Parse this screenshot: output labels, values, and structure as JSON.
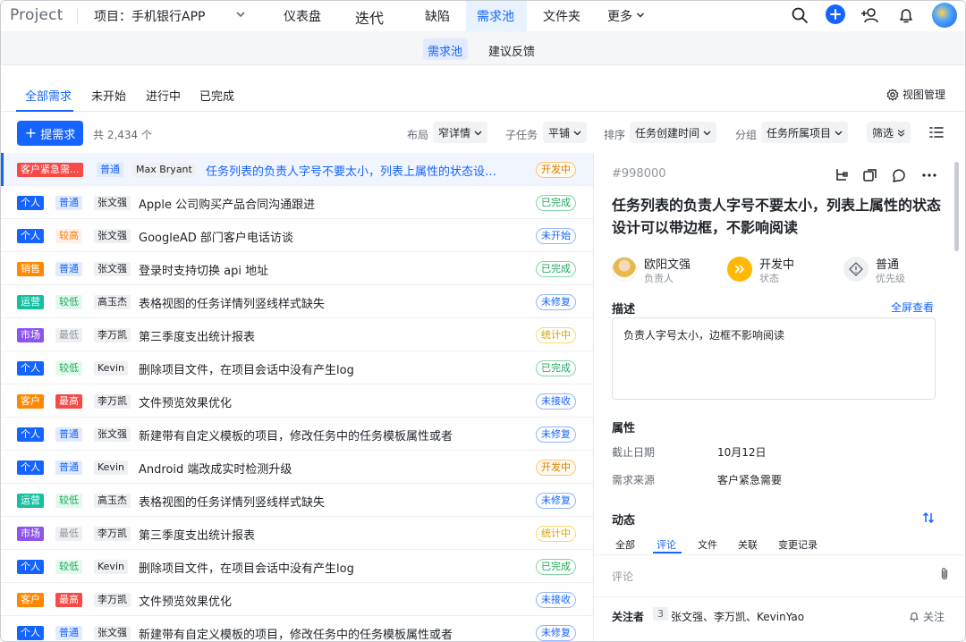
{
  "app": {
    "logo": "Project",
    "project": "项目：手机银行APP"
  },
  "nav": {
    "items": [
      "仪表盘",
      "迭代",
      "缺陷",
      "需求池",
      "文件夹",
      "更多"
    ],
    "active": "需求池"
  },
  "subnav": {
    "items": [
      "需求池",
      "建议反馈"
    ],
    "active": "需求池"
  },
  "tabs": {
    "items": [
      "全部需求",
      "未开始",
      "进行中",
      "已完成"
    ],
    "active": "全部需求",
    "view_manager": "视图管理"
  },
  "toolbar": {
    "new_button": "提需求",
    "total": "共 2,434 个",
    "layout_label": "布局",
    "layout_value": "窄详情",
    "subtask_label": "子任务",
    "subtask_value": "平铺",
    "sort_label": "排序",
    "sort_value": "任务创建时间",
    "group_label": "分组",
    "group_value": "任务所属项目",
    "filter_label": "筛选"
  },
  "colors": {
    "accent": "#1664ff",
    "tag_red": "#f54a45",
    "tag_blue": "#1664ff",
    "tag_orange": "#ff8800",
    "tag_teal": "#14c0a0",
    "tag_purple": "#8d55ed"
  },
  "rows": [
    {
      "tag": "客户紧急需...",
      "tag_color": "#f54a45",
      "priority": "普通",
      "owner": "Max Bryant",
      "title": "任务列表的负责人字号不要太小，列表上属性的状态设计...",
      "status": "开发中",
      "selected": true
    },
    {
      "tag": "个人",
      "tag_color": "#1664ff",
      "priority": "普通",
      "owner": "张文强",
      "title": "Apple 公司购买产品合同沟通跟进",
      "status": "已完成"
    },
    {
      "tag": "个人",
      "tag_color": "#1664ff",
      "priority": "较高",
      "owner": "张文强",
      "title": "GoogleAD 部门客户电话访谈",
      "status": "未开始"
    },
    {
      "tag": "销售",
      "tag_color": "#ff8800",
      "priority": "普通",
      "owner": "张文强",
      "title": "登录时支持切换 api 地址",
      "status": "已完成"
    },
    {
      "tag": "运营",
      "tag_color": "#14c0a0",
      "priority": "较低",
      "owner": "高玉杰",
      "title": "表格视图的任务详情列竖线样式缺失",
      "status": "未修复"
    },
    {
      "tag": "市场",
      "tag_color": "#8d55ed",
      "priority": "最低",
      "owner": "李万凯",
      "title": "第三季度支出统计报表",
      "status": "统计中"
    },
    {
      "tag": "个人",
      "tag_color": "#1664ff",
      "priority": "较低",
      "owner": "Kevin",
      "title": "删除项目文件，在项目会话中没有产生log",
      "status": "已完成"
    },
    {
      "tag": "客户",
      "tag_color": "#ff8800",
      "priority": "最高",
      "owner": "李万凯",
      "title": "文件预览效果优化",
      "status": "未接收"
    },
    {
      "tag": "个人",
      "tag_color": "#1664ff",
      "priority": "普通",
      "owner": "张文强",
      "title": "新建带有自定义模板的项目，修改任务中的任务模板属性或者",
      "status": "未修复"
    },
    {
      "tag": "个人",
      "tag_color": "#1664ff",
      "priority": "普通",
      "owner": "Kevin",
      "title": "Android 端改成实时检测升级",
      "status": "开发中"
    },
    {
      "tag": "运营",
      "tag_color": "#14c0a0",
      "priority": "较低",
      "owner": "高玉杰",
      "title": "表格视图的任务详情列竖线样式缺失",
      "status": "未修复"
    },
    {
      "tag": "市场",
      "tag_color": "#8d55ed",
      "priority": "最低",
      "owner": "李万凯",
      "title": "第三季度支出统计报表",
      "status": "统计中"
    },
    {
      "tag": "个人",
      "tag_color": "#1664ff",
      "priority": "较低",
      "owner": "Kevin",
      "title": "删除项目文件，在项目会话中没有产生log",
      "status": "已完成"
    },
    {
      "tag": "客户",
      "tag_color": "#ff8800",
      "priority": "最高",
      "owner": "李万凯",
      "title": "文件预览效果优化",
      "status": "未接收"
    },
    {
      "tag": "个人",
      "tag_color": "#1664ff",
      "priority": "普通",
      "owner": "张文强",
      "title": "新建带有自定义模板的项目，修改任务中的任务模板属性或者",
      "status": "未修复"
    }
  ],
  "detail": {
    "id": "#998000",
    "title": "任务列表的负责人字号不要太小，列表上属性的状态设计可以带边框，不影响阅读",
    "assignee": "欧阳文强",
    "assignee_label": "负责人",
    "status": "开发中",
    "status_label": "状态",
    "priority": "普通",
    "priority_label": "优先级",
    "desc_heading": "描述",
    "full_view": "全屏查看",
    "description": "负责人字号太小，边框不影响阅读",
    "attr_heading": "属性",
    "due_label": "截止日期",
    "due_value": "10月12日",
    "source_label": "需求来源",
    "source_value": "客户紧急需要",
    "activity_heading": "动态",
    "activity_tabs": [
      "全部",
      "评论",
      "文件",
      "关联",
      "变更记录"
    ],
    "activity_active": "评论",
    "comment_placeholder": "评论",
    "followers_label": "关注者",
    "followers_count": "3",
    "followers": "张文强、李万凯、KevinYao",
    "follow_button": "关注"
  }
}
